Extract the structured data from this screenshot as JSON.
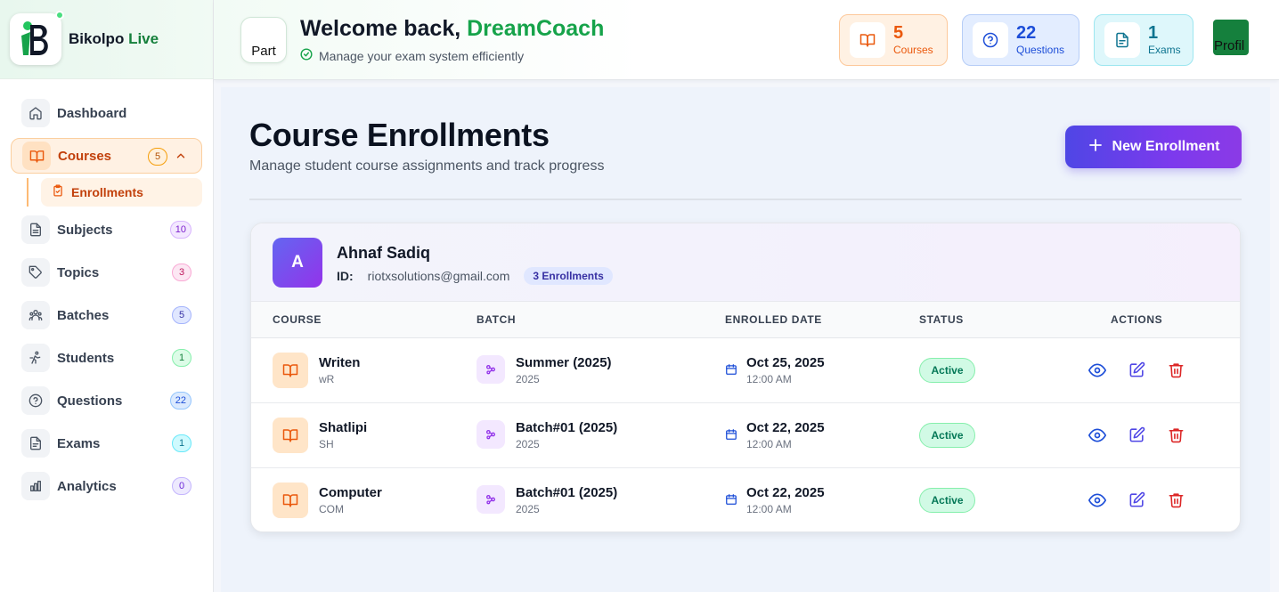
{
  "brand": {
    "name_main": "Bikolpo",
    "name_accent": " Live"
  },
  "sidebar": {
    "items": [
      {
        "label": "Dashboard",
        "badge": null
      },
      {
        "label": "Courses",
        "badge": "5"
      },
      {
        "label": "Subjects",
        "badge": "10",
        "color": "#7e22ce"
      },
      {
        "label": "Topics",
        "badge": "3",
        "color": "#be185d"
      },
      {
        "label": "Batches",
        "badge": "5",
        "color": "#3730a3"
      },
      {
        "label": "Students",
        "badge": "1",
        "color": "#15803d"
      },
      {
        "label": "Questions",
        "badge": "22",
        "color": "#1d4ed8"
      },
      {
        "label": "Exams",
        "badge": "1",
        "color": "#0e7490"
      },
      {
        "label": "Analytics",
        "badge": "0",
        "color": "#6d28d9"
      }
    ],
    "sub_item": {
      "label": "Enrollments"
    }
  },
  "header": {
    "avatar_alt": "Part",
    "welcome_prefix": "Welcome back, ",
    "user_name": "DreamCoach",
    "subtitle": "Manage your exam system efficiently",
    "stats": [
      {
        "value": "5",
        "label": "Courses"
      },
      {
        "value": "22",
        "label": "Questions"
      },
      {
        "value": "1",
        "label": "Exams"
      }
    ],
    "profile_alt": "Profil"
  },
  "page": {
    "title": "Course Enrollments",
    "subtitle": "Manage student course assignments and track progress",
    "new_button": "New Enrollment"
  },
  "student": {
    "initial": "A",
    "name": "Ahnaf Sadiq",
    "id_label": "ID:",
    "email": "riotxsolutions@gmail.com",
    "enrollments_badge": "3 Enrollments"
  },
  "table": {
    "headers": [
      "COURSE",
      "BATCH",
      "ENROLLED DATE",
      "STATUS",
      "ACTIONS"
    ],
    "rows": [
      {
        "course": "Writen",
        "code": "wR",
        "batch": "Summer (2025)",
        "year": "2025",
        "date": "Oct 25, 2025",
        "time": "12:00 AM",
        "status": "Active"
      },
      {
        "course": "Shatlipi",
        "code": "SH",
        "batch": "Batch#01 (2025)",
        "year": "2025",
        "date": "Oct 22, 2025",
        "time": "12:00 AM",
        "status": "Active"
      },
      {
        "course": "Computer",
        "code": "COM",
        "batch": "Batch#01 (2025)",
        "year": "2025",
        "date": "Oct 22, 2025",
        "time": "12:00 AM",
        "status": "Active"
      }
    ]
  },
  "colors": {
    "accent_green": "#16a34a",
    "accent_orange": "#ea580c",
    "primary_button": "#6d3ee8",
    "view_icon": "#1d4ed8",
    "edit_icon": "#4f46e5",
    "delete_icon": "#dc2626"
  },
  "icons": {
    "dashboard": "home-icon",
    "courses": "book-open-icon",
    "subjects": "file-icon",
    "topics": "tag-icon",
    "batches": "users-icon",
    "students": "student-icon",
    "questions": "help-circle-icon",
    "exams": "file-text-icon",
    "analytics": "bar-chart-icon",
    "enrollments": "clipboard-check-icon",
    "view": "eye-icon",
    "edit": "edit-icon",
    "delete": "trash-icon"
  }
}
